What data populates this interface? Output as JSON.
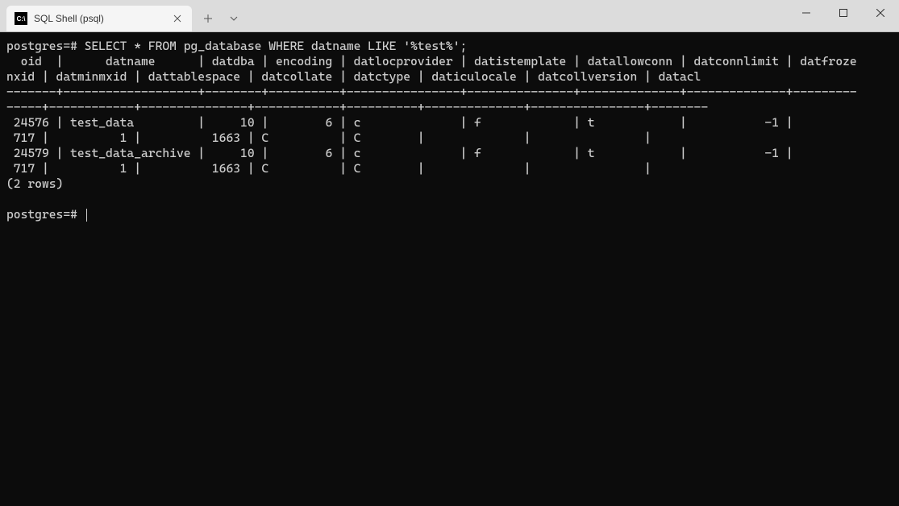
{
  "window": {
    "tab_title": "SQL Shell (psql)"
  },
  "terminal": {
    "prompt": "postgres=#",
    "command": "SELECT * FROM pg_database WHERE datname LIKE '%test%';",
    "columns_line1": "  oid  |      datname      | datdba | encoding | datlocprovider | datistemplate | datallowconn | datconnlimit | datfroze",
    "columns_line2": "nxid | datminmxid | dattablespace | datcollate | datctype | daticulocale | datcollversion | datacl",
    "separator_line1": "-------+-------------------+--------+----------+----------------+---------------+--------------+--------------+---------",
    "separator_line2": "-----+------------+---------------+------------+----------+--------------+----------------+--------",
    "row1_line1": " 24576 | test_data         |     10 |        6 | c              | f             | t            |           -1 |",
    "row1_line2": " 717 |          1 |          1663 | C          | C        |              |                |",
    "row2_line1": " 24579 | test_data_archive |     10 |        6 | c              | f             | t            |           -1 |",
    "row2_line2": " 717 |          1 |          1663 | C          | C        |              |                |",
    "rowcount": "(2 rows)",
    "prompt2": "postgres=# "
  },
  "chart_data": {
    "type": "table",
    "title": "pg_database rows matching '%test%'",
    "columns": [
      "oid",
      "datname",
      "datdba",
      "encoding",
      "datlocprovider",
      "datistemplate",
      "datallowconn",
      "datconnlimit",
      "datfrozenxid",
      "datminmxid",
      "dattablespace",
      "datcollate",
      "datctype",
      "daticulocale",
      "datcollversion",
      "datacl"
    ],
    "rows": [
      {
        "oid": 24576,
        "datname": "test_data",
        "datdba": 10,
        "encoding": 6,
        "datlocprovider": "c",
        "datistemplate": "f",
        "datallowconn": "t",
        "datconnlimit": -1,
        "datfrozenxid": 717,
        "datminmxid": 1,
        "dattablespace": 1663,
        "datcollate": "C",
        "datctype": "C",
        "daticulocale": "",
        "datcollversion": "",
        "datacl": ""
      },
      {
        "oid": 24579,
        "datname": "test_data_archive",
        "datdba": 10,
        "encoding": 6,
        "datlocprovider": "c",
        "datistemplate": "f",
        "datallowconn": "t",
        "datconnlimit": -1,
        "datfrozenxid": 717,
        "datminmxid": 1,
        "dattablespace": 1663,
        "datcollate": "C",
        "datctype": "C",
        "daticulocale": "",
        "datcollversion": "",
        "datacl": ""
      }
    ],
    "row_count": 2
  }
}
